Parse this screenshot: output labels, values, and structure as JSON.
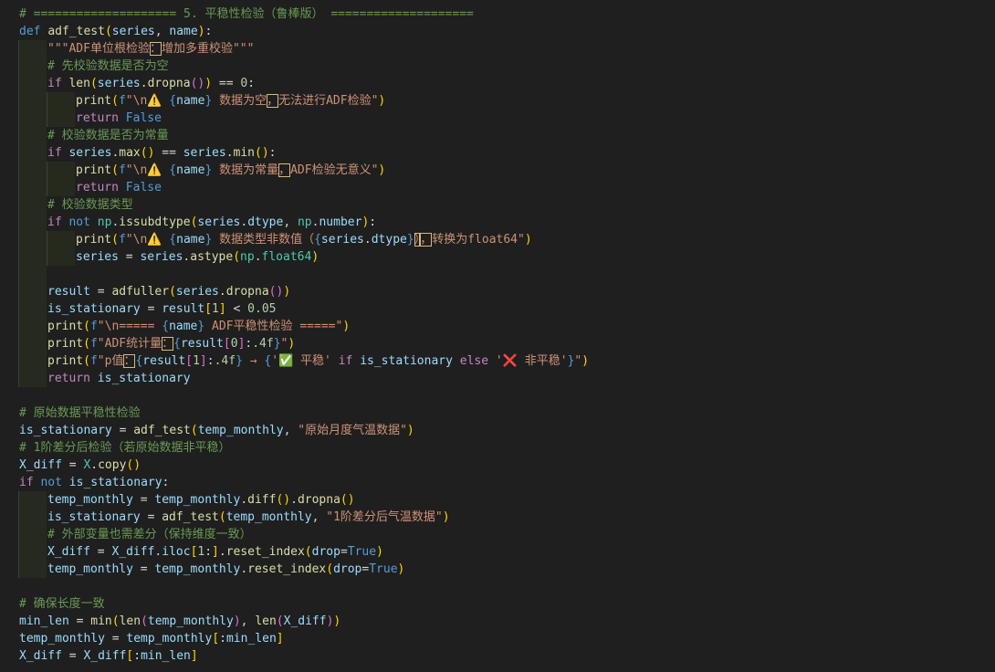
{
  "colors": {
    "background": "#1f1f1f",
    "keyword": "#569cd6",
    "control": "#c586c0",
    "function": "#dcdcaa",
    "string": "#ce9178",
    "comment": "#6a9955",
    "number": "#b5cea8",
    "variable": "#9cdcfe",
    "type": "#4ec9b0",
    "bracket1": "#ffd700",
    "bracket2": "#da70d6",
    "bracket3": "#179fff",
    "ambiguous_char_box": "#d7ba7d",
    "indent_guide": "#262a1e"
  },
  "icons": {
    "warning": "warning-sign-emoji",
    "check": "check-mark-emoji",
    "cross": "cross-mark-emoji"
  },
  "lines": [
    {
      "indent": 0,
      "tokens": [
        [
          "cmt",
          "# ==================== 5. 平稳性检验（鲁棒版） ===================="
        ]
      ]
    },
    {
      "indent": 0,
      "tokens": [
        [
          "kw",
          "def"
        ],
        [
          "ob",
          " "
        ],
        [
          "fn",
          "adf_test"
        ],
        [
          "p1",
          "("
        ],
        [
          "var",
          "series"
        ],
        [
          "ob",
          ", "
        ],
        [
          "var",
          "name"
        ],
        [
          "p1",
          ")"
        ],
        [
          "ob",
          ":"
        ]
      ]
    },
    {
      "indent": 1,
      "tokens": [
        [
          "str",
          "\"\"\"ADF单位根检验"
        ],
        [
          "amb",
          "："
        ],
        [
          "str",
          "增加多重校验\"\"\""
        ]
      ]
    },
    {
      "indent": 1,
      "tokens": [
        [
          "cmt",
          "# 先校验数据是否为空"
        ]
      ]
    },
    {
      "indent": 1,
      "tokens": [
        [
          "ctl",
          "if"
        ],
        [
          "ob",
          " "
        ],
        [
          "fn",
          "len"
        ],
        [
          "p1",
          "("
        ],
        [
          "var",
          "series"
        ],
        [
          "ob",
          "."
        ],
        [
          "fn",
          "dropna"
        ],
        [
          "p2",
          "()"
        ],
        [
          "p1",
          ")"
        ],
        [
          "ob",
          " == "
        ],
        [
          "num",
          "0"
        ],
        [
          "ob",
          ":"
        ]
      ]
    },
    {
      "indent": 2,
      "tokens": [
        [
          "fn",
          "print"
        ],
        [
          "p1",
          "("
        ],
        [
          "kw",
          "f"
        ],
        [
          "str",
          "\"\\n"
        ],
        [
          "warn",
          "⚠️"
        ],
        [
          "str",
          " "
        ],
        [
          "kw",
          "{"
        ],
        [
          "var",
          "name"
        ],
        [
          "kw",
          "}"
        ],
        [
          "str",
          " 数据为空"
        ],
        [
          "amb",
          "，"
        ],
        [
          "str",
          "无法进行ADF检验\""
        ],
        [
          "p1",
          ")"
        ]
      ]
    },
    {
      "indent": 2,
      "tokens": [
        [
          "ctl",
          "return"
        ],
        [
          "ob",
          " "
        ],
        [
          "kw",
          "False"
        ]
      ]
    },
    {
      "indent": 1,
      "tokens": [
        [
          "cmt",
          "# 校验数据是否为常量"
        ]
      ]
    },
    {
      "indent": 1,
      "tokens": [
        [
          "ctl",
          "if"
        ],
        [
          "ob",
          " "
        ],
        [
          "var",
          "series"
        ],
        [
          "ob",
          "."
        ],
        [
          "fn",
          "max"
        ],
        [
          "p1",
          "()"
        ],
        [
          "ob",
          " == "
        ],
        [
          "var",
          "series"
        ],
        [
          "ob",
          "."
        ],
        [
          "fn",
          "min"
        ],
        [
          "p1",
          "()"
        ],
        [
          "ob",
          ":"
        ]
      ]
    },
    {
      "indent": 2,
      "tokens": [
        [
          "fn",
          "print"
        ],
        [
          "p1",
          "("
        ],
        [
          "kw",
          "f"
        ],
        [
          "str",
          "\"\\n"
        ],
        [
          "warn",
          "⚠️"
        ],
        [
          "str",
          " "
        ],
        [
          "kw",
          "{"
        ],
        [
          "var",
          "name"
        ],
        [
          "kw",
          "}"
        ],
        [
          "str",
          " 数据为常量"
        ],
        [
          "amb",
          "，"
        ],
        [
          "str",
          "ADF检验无意义\""
        ],
        [
          "p1",
          ")"
        ]
      ]
    },
    {
      "indent": 2,
      "tokens": [
        [
          "ctl",
          "return"
        ],
        [
          "ob",
          " "
        ],
        [
          "kw",
          "False"
        ]
      ]
    },
    {
      "indent": 1,
      "tokens": [
        [
          "cmt",
          "# 校验数据类型"
        ]
      ]
    },
    {
      "indent": 1,
      "tokens": [
        [
          "ctl",
          "if"
        ],
        [
          "ob",
          " "
        ],
        [
          "kw",
          "not"
        ],
        [
          "ob",
          " "
        ],
        [
          "typ",
          "np"
        ],
        [
          "ob",
          "."
        ],
        [
          "fn",
          "issubdtype"
        ],
        [
          "p1",
          "("
        ],
        [
          "var",
          "series"
        ],
        [
          "ob",
          "."
        ],
        [
          "var",
          "dtype"
        ],
        [
          "ob",
          ", "
        ],
        [
          "typ",
          "np"
        ],
        [
          "ob",
          "."
        ],
        [
          "var",
          "number"
        ],
        [
          "p1",
          ")"
        ],
        [
          "ob",
          ":"
        ]
      ]
    },
    {
      "indent": 2,
      "tokens": [
        [
          "fn",
          "print"
        ],
        [
          "p1",
          "("
        ],
        [
          "kw",
          "f"
        ],
        [
          "str",
          "\"\\n"
        ],
        [
          "warn",
          "⚠️"
        ],
        [
          "str",
          " "
        ],
        [
          "kw",
          "{"
        ],
        [
          "var",
          "name"
        ],
        [
          "kw",
          "}"
        ],
        [
          "str",
          " 数据类型非数值（"
        ],
        [
          "kw",
          "{"
        ],
        [
          "var",
          "series"
        ],
        [
          "ob",
          "."
        ],
        [
          "var",
          "dtype"
        ],
        [
          "kw",
          "}"
        ],
        [
          "amb",
          "）"
        ],
        [
          "amb",
          "，"
        ],
        [
          "str",
          "转换为float64\""
        ],
        [
          "p1",
          ")"
        ]
      ]
    },
    {
      "indent": 2,
      "tokens": [
        [
          "var",
          "series"
        ],
        [
          "ob",
          " = "
        ],
        [
          "var",
          "series"
        ],
        [
          "ob",
          "."
        ],
        [
          "fn",
          "astype"
        ],
        [
          "p1",
          "("
        ],
        [
          "typ",
          "np"
        ],
        [
          "ob",
          "."
        ],
        [
          "typ",
          "float64"
        ],
        [
          "p1",
          ")"
        ]
      ]
    },
    {
      "indent": 1,
      "tokens": [
        [
          "ob",
          ""
        ]
      ]
    },
    {
      "indent": 1,
      "tokens": [
        [
          "var",
          "result"
        ],
        [
          "ob",
          " = "
        ],
        [
          "fn",
          "adfuller"
        ],
        [
          "p1",
          "("
        ],
        [
          "var",
          "series"
        ],
        [
          "ob",
          "."
        ],
        [
          "fn",
          "dropna"
        ],
        [
          "p2",
          "()"
        ],
        [
          "p1",
          ")"
        ]
      ]
    },
    {
      "indent": 1,
      "tokens": [
        [
          "var",
          "is_stationary"
        ],
        [
          "ob",
          " = "
        ],
        [
          "var",
          "result"
        ],
        [
          "p1",
          "["
        ],
        [
          "num",
          "1"
        ],
        [
          "p1",
          "]"
        ],
        [
          "ob",
          " < "
        ],
        [
          "num",
          "0.05"
        ]
      ]
    },
    {
      "indent": 1,
      "tokens": [
        [
          "fn",
          "print"
        ],
        [
          "p1",
          "("
        ],
        [
          "kw",
          "f"
        ],
        [
          "str",
          "\"\\n===== "
        ],
        [
          "kw",
          "{"
        ],
        [
          "var",
          "name"
        ],
        [
          "kw",
          "}"
        ],
        [
          "str",
          " ADF平稳性检验 =====\""
        ],
        [
          "p1",
          ")"
        ]
      ]
    },
    {
      "indent": 1,
      "tokens": [
        [
          "fn",
          "print"
        ],
        [
          "p1",
          "("
        ],
        [
          "kw",
          "f"
        ],
        [
          "str",
          "\"ADF统计量"
        ],
        [
          "amb",
          "："
        ],
        [
          "kw",
          "{"
        ],
        [
          "var",
          "result"
        ],
        [
          "p2",
          "["
        ],
        [
          "num",
          "0"
        ],
        [
          "p2",
          "]"
        ],
        [
          "ob",
          ":"
        ],
        [
          "num",
          ".4f"
        ],
        [
          "kw",
          "}"
        ],
        [
          "str",
          "\""
        ],
        [
          "p1",
          ")"
        ]
      ]
    },
    {
      "indent": 1,
      "tokens": [
        [
          "fn",
          "print"
        ],
        [
          "p1",
          "("
        ],
        [
          "kw",
          "f"
        ],
        [
          "str",
          "\"p值"
        ],
        [
          "amb",
          "："
        ],
        [
          "kw",
          "{"
        ],
        [
          "var",
          "result"
        ],
        [
          "p2",
          "["
        ],
        [
          "num",
          "1"
        ],
        [
          "p2",
          "]"
        ],
        [
          "ob",
          ":"
        ],
        [
          "num",
          ".4f"
        ],
        [
          "kw",
          "}"
        ],
        [
          "str",
          " → "
        ],
        [
          "kw",
          "{"
        ],
        [
          "str",
          "'"
        ],
        [
          "ok",
          "✅"
        ],
        [
          "str",
          " 平稳'"
        ],
        [
          "ob",
          " "
        ],
        [
          "ctl",
          "if"
        ],
        [
          "ob",
          " "
        ],
        [
          "var",
          "is_stationary"
        ],
        [
          "ob",
          " "
        ],
        [
          "ctl",
          "else"
        ],
        [
          "ob",
          " "
        ],
        [
          "str",
          "'"
        ],
        [
          "bad",
          "❌"
        ],
        [
          "str",
          " 非平稳'"
        ],
        [
          "kw",
          "}"
        ],
        [
          "str",
          "\""
        ],
        [
          "p1",
          ")"
        ]
      ]
    },
    {
      "indent": 1,
      "tokens": [
        [
          "ctl",
          "return"
        ],
        [
          "ob",
          " "
        ],
        [
          "var",
          "is_stationary"
        ]
      ]
    },
    {
      "indent": 0,
      "tokens": [
        [
          "ob",
          ""
        ]
      ]
    },
    {
      "indent": 0,
      "tokens": [
        [
          "cmt",
          "# 原始数据平稳性检验"
        ]
      ]
    },
    {
      "indent": 0,
      "tokens": [
        [
          "var",
          "is_stationary"
        ],
        [
          "ob",
          " = "
        ],
        [
          "fn",
          "adf_test"
        ],
        [
          "p1",
          "("
        ],
        [
          "var",
          "temp_monthly"
        ],
        [
          "ob",
          ", "
        ],
        [
          "str",
          "\"原始月度气温数据\""
        ],
        [
          "p1",
          ")"
        ]
      ]
    },
    {
      "indent": 0,
      "tokens": [
        [
          "cmt",
          "# 1阶差分后检验（若原始数据非平稳）"
        ]
      ]
    },
    {
      "indent": 0,
      "tokens": [
        [
          "var",
          "X_diff"
        ],
        [
          "ob",
          " = "
        ],
        [
          "typ",
          "X"
        ],
        [
          "ob",
          "."
        ],
        [
          "fn",
          "copy"
        ],
        [
          "p1",
          "()"
        ]
      ]
    },
    {
      "indent": 0,
      "tokens": [
        [
          "ctl",
          "if"
        ],
        [
          "ob",
          " "
        ],
        [
          "kw",
          "not"
        ],
        [
          "ob",
          " "
        ],
        [
          "var",
          "is_stationary"
        ],
        [
          "ob",
          ":"
        ]
      ]
    },
    {
      "indent": 1,
      "tokens": [
        [
          "var",
          "temp_monthly"
        ],
        [
          "ob",
          " = "
        ],
        [
          "var",
          "temp_monthly"
        ],
        [
          "ob",
          "."
        ],
        [
          "fn",
          "diff"
        ],
        [
          "p1",
          "()"
        ],
        [
          "ob",
          "."
        ],
        [
          "fn",
          "dropna"
        ],
        [
          "p1",
          "()"
        ]
      ]
    },
    {
      "indent": 1,
      "tokens": [
        [
          "var",
          "is_stationary"
        ],
        [
          "ob",
          " = "
        ],
        [
          "fn",
          "adf_test"
        ],
        [
          "p1",
          "("
        ],
        [
          "var",
          "temp_monthly"
        ],
        [
          "ob",
          ", "
        ],
        [
          "str",
          "\"1阶差分后气温数据\""
        ],
        [
          "p1",
          ")"
        ]
      ]
    },
    {
      "indent": 1,
      "tokens": [
        [
          "cmt",
          "# 外部变量也需差分（保持维度一致）"
        ]
      ]
    },
    {
      "indent": 1,
      "tokens": [
        [
          "var",
          "X_diff"
        ],
        [
          "ob",
          " = "
        ],
        [
          "var",
          "X_diff"
        ],
        [
          "ob",
          "."
        ],
        [
          "var",
          "iloc"
        ],
        [
          "p1",
          "["
        ],
        [
          "num",
          "1"
        ],
        [
          "ob",
          ":"
        ],
        [
          "p1",
          "]"
        ],
        [
          "ob",
          "."
        ],
        [
          "fn",
          "reset_index"
        ],
        [
          "p1",
          "("
        ],
        [
          "var",
          "drop"
        ],
        [
          "ob",
          "="
        ],
        [
          "kw",
          "True"
        ],
        [
          "p1",
          ")"
        ]
      ]
    },
    {
      "indent": 1,
      "tokens": [
        [
          "var",
          "temp_monthly"
        ],
        [
          "ob",
          " = "
        ],
        [
          "var",
          "temp_monthly"
        ],
        [
          "ob",
          "."
        ],
        [
          "fn",
          "reset_index"
        ],
        [
          "p1",
          "("
        ],
        [
          "var",
          "drop"
        ],
        [
          "ob",
          "="
        ],
        [
          "kw",
          "True"
        ],
        [
          "p1",
          ")"
        ]
      ]
    },
    {
      "indent": 0,
      "tokens": [
        [
          "ob",
          ""
        ]
      ]
    },
    {
      "indent": 0,
      "tokens": [
        [
          "cmt",
          "# 确保长度一致"
        ]
      ]
    },
    {
      "indent": 0,
      "tokens": [
        [
          "var",
          "min_len"
        ],
        [
          "ob",
          " = "
        ],
        [
          "fn",
          "min"
        ],
        [
          "p1",
          "("
        ],
        [
          "fn",
          "len"
        ],
        [
          "p2",
          "("
        ],
        [
          "var",
          "temp_monthly"
        ],
        [
          "p2",
          ")"
        ],
        [
          "ob",
          ", "
        ],
        [
          "fn",
          "len"
        ],
        [
          "p2",
          "("
        ],
        [
          "var",
          "X_diff"
        ],
        [
          "p2",
          ")"
        ],
        [
          "p1",
          ")"
        ]
      ]
    },
    {
      "indent": 0,
      "tokens": [
        [
          "var",
          "temp_monthly"
        ],
        [
          "ob",
          " = "
        ],
        [
          "var",
          "temp_monthly"
        ],
        [
          "p1",
          "["
        ],
        [
          "ob",
          ":"
        ],
        [
          "var",
          "min_len"
        ],
        [
          "p1",
          "]"
        ]
      ]
    },
    {
      "indent": 0,
      "tokens": [
        [
          "var",
          "X_diff"
        ],
        [
          "ob",
          " = "
        ],
        [
          "var",
          "X_diff"
        ],
        [
          "p1",
          "["
        ],
        [
          "ob",
          ":"
        ],
        [
          "var",
          "min_len"
        ],
        [
          "p1",
          "]"
        ]
      ]
    }
  ]
}
